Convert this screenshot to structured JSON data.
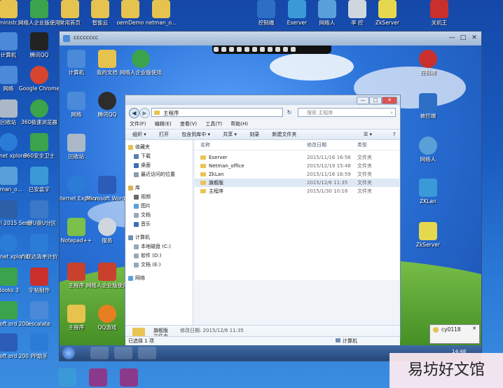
{
  "host_desktop": {
    "top_row": [
      "dministr...",
      "网络人企业版使用教程",
      "常用首页",
      "智能云",
      "oemDemo",
      "netman_o...",
      "控制端",
      "Eserver",
      "网络人",
      "李 控",
      "ZkServer",
      "关机王"
    ],
    "left_column": [
      "计算机",
      "腾讯QQ",
      "网络",
      "Google Chrome",
      "回收站",
      "360极速浏览器",
      "nternet xplorer",
      "360安全卫士",
      "etman_o...",
      "已安装字",
      "Ins.UI 2015 Scan",
      "一键U盘U分区",
      "Internet xplorer",
      "广联达清单计价",
      "Books 3",
      "字帖制作",
      "icrosoft ord 2003",
      "escalate",
      "icrosoft ord 2003",
      "PP助手",
      "...",
      "ZkServer",
      "..."
    ]
  },
  "remote_window": {
    "title": "cccccccc",
    "controls": [
      "—",
      "□",
      "✕"
    ]
  },
  "remote_desktop_icons": [
    {
      "label": "计算机",
      "color": "#4a8ad8"
    },
    {
      "label": "我的文档",
      "color": "#e6c24e"
    },
    {
      "label": "网络人企业版使用教程",
      "color": "#3aa34b"
    },
    {
      "label": "网络",
      "color": "#4a8ad8"
    },
    {
      "label": "腾讯QQ",
      "color": "#2d2d2d"
    },
    {
      "label": "回收站",
      "color": "#aab8c8"
    },
    {
      "label": "Internet Explorer",
      "color": "#2a7cd6"
    },
    {
      "label": "Microsoft Word 2003",
      "color": "#2a5cb8"
    },
    {
      "label": "Notepad++",
      "color": "#7ac04a"
    },
    {
      "label": "服务",
      "color": "#cfd6de"
    },
    {
      "label": "主程序",
      "color": "#c9402c"
    },
    {
      "label": "网络人企业版使用教程",
      "color": "#c9402c"
    },
    {
      "label": "主程序",
      "color": "#e6c24e"
    },
    {
      "label": "QQ游戏",
      "color": "#e67e22"
    }
  ],
  "remote_right_icons": [
    "控制端",
    "被控端",
    "网络人",
    "ZKLan",
    "ZkServer"
  ],
  "explorer": {
    "address": "主程序",
    "search_placeholder": "搜索 主程序",
    "menu": [
      "文件(F)",
      "编辑(E)",
      "查看(V)",
      "工具(T)",
      "帮助(H)"
    ],
    "commands": [
      "组织 ▾",
      "打开",
      "包含到库中 ▾",
      "共享 ▾",
      "刻录",
      "新建文件夹"
    ],
    "nav": [
      {
        "label": "收藏夹",
        "top": true,
        "color": "#e6c24e"
      },
      {
        "label": "下载",
        "top": false,
        "color": "#5b7fb0"
      },
      {
        "label": "桌面",
        "top": false,
        "color": "#3c6fb5"
      },
      {
        "label": "最近访问的位置",
        "top": false,
        "color": "#8b9bb0"
      },
      {
        "label": "库",
        "top": true,
        "color": "#d8b45a"
      },
      {
        "label": "视频",
        "top": false,
        "color": "#6a6a6a"
      },
      {
        "label": "图片",
        "top": false,
        "color": "#5aa0d8"
      },
      {
        "label": "文档",
        "top": false,
        "color": "#9aa8b8"
      },
      {
        "label": "音乐",
        "top": false,
        "color": "#3c6fb5"
      },
      {
        "label": "计算机",
        "top": true,
        "color": "#6f8fb8"
      },
      {
        "label": "本地磁盘 (C:)",
        "top": false,
        "color": "#9aa8b8"
      },
      {
        "label": "软件 (D:)",
        "top": false,
        "color": "#9aa8b8"
      },
      {
        "label": "文档 (E:)",
        "top": false,
        "color": "#9aa8b8"
      },
      {
        "label": "网络",
        "top": true,
        "color": "#5aa0d8"
      }
    ],
    "columns": {
      "name": "名称",
      "date": "修改日期",
      "type": "类型"
    },
    "files": [
      {
        "name": "Eserver",
        "date": "2015/11/16 16:56",
        "type": "文件夹"
      },
      {
        "name": "Netman_office",
        "date": "2015/12/19 15:48",
        "type": "文件夹"
      },
      {
        "name": "ZkLan",
        "date": "2015/11/16 16:59",
        "type": "文件夹"
      },
      {
        "name": "旗舰版",
        "date": "2015/12/6 11:35",
        "type": "文件夹"
      },
      {
        "name": "主程序",
        "date": "2015/1/30 10:18",
        "type": "文件夹"
      }
    ],
    "details": {
      "name": "旗舰版",
      "modified": "修改日期: 2015/12/6 11:35",
      "kind": "文件夹"
    },
    "status_left": "已选择 1 项",
    "status_right": "计算机"
  },
  "notification": {
    "title": "cy0118",
    "time": "14:48"
  },
  "watermark": "易坊好文馆"
}
